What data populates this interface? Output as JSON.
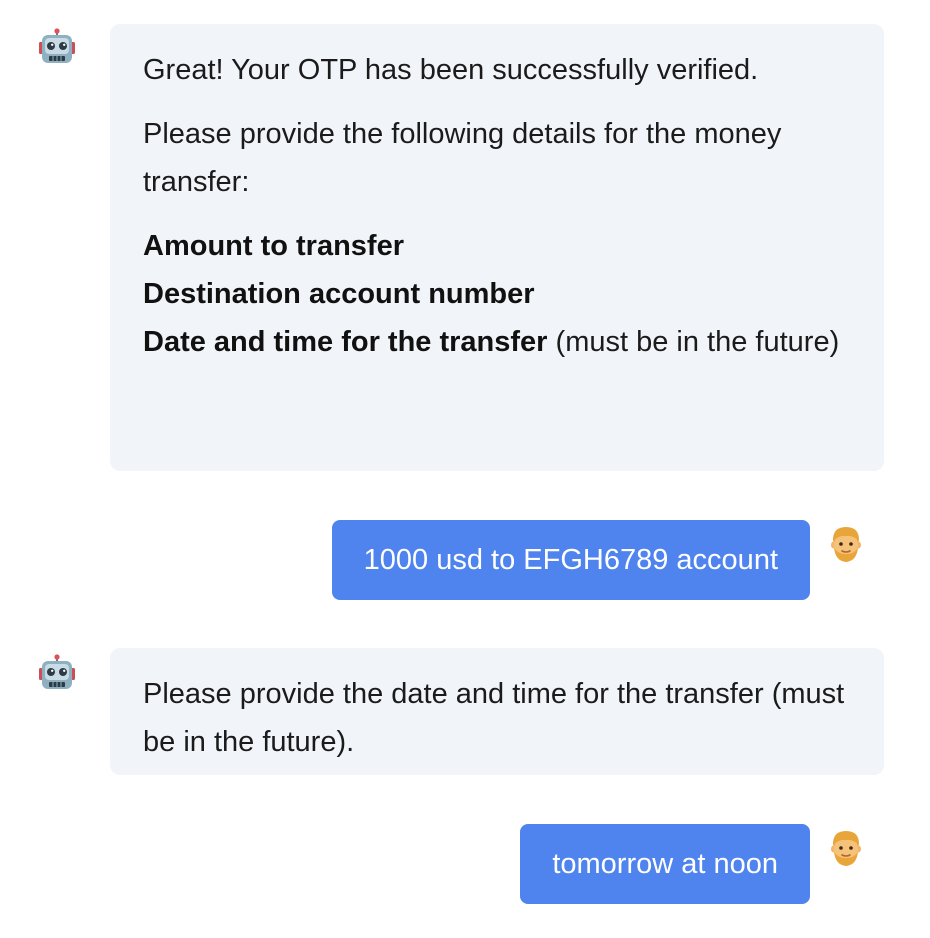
{
  "messages": [
    {
      "role": "bot",
      "avatar_icon": "robot-icon",
      "para1": "Great! Your OTP has been successfully verified.",
      "para2": "Please provide the following details for the money transfer:",
      "list": [
        "Amount to transfer",
        "Destination account number",
        "Date and time for the transfer"
      ],
      "list_suffix": " (must be in the future)"
    },
    {
      "role": "user",
      "avatar_icon": "person-icon",
      "text": "1000 usd to EFGH6789 account"
    },
    {
      "role": "bot",
      "avatar_icon": "robot-icon",
      "text": "Please provide the date and time for the transfer (must be in the future)."
    },
    {
      "role": "user",
      "avatar_icon": "person-icon",
      "text": "tomorrow at noon"
    }
  ],
  "colors": {
    "bot_bubble": "#f1f5f9",
    "user_bubble": "#4f83ee"
  }
}
